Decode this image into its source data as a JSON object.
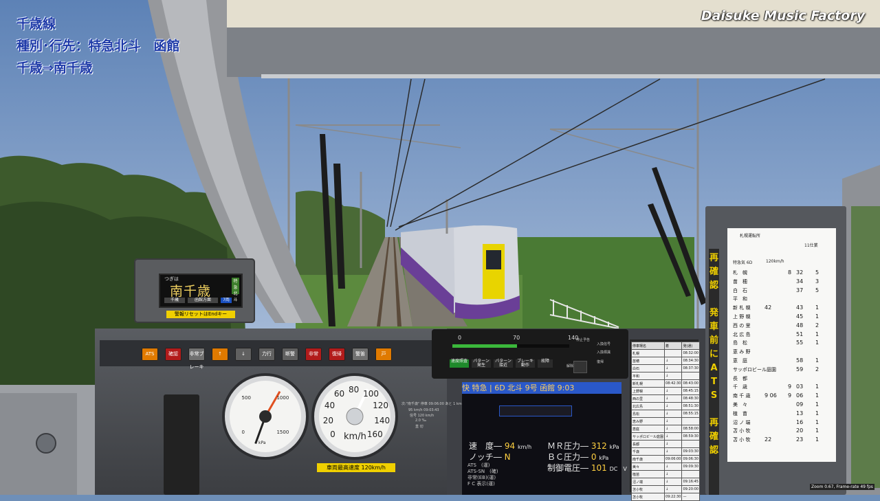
{
  "overlay": {
    "line_name": "千歳線",
    "service": "種別･行先：特急北斗　函館",
    "section": "千歳⇒南千歳",
    "watermark": "Daisuke Music Factory"
  },
  "destination_display": {
    "next_label": "つぎは",
    "station": "南千歳",
    "side_tag": "特急 北斗",
    "seg1": "千歳",
    "seg2": "函館方面",
    "car": "7両",
    "warning": "警報リセットはEndキー"
  },
  "buttons": [
    "ATS",
    "確認",
    "非常ブレーキ",
    "↑",
    "↓",
    "力行",
    "断警",
    "非常",
    "復帰",
    "警笛",
    "戸"
  ],
  "gauges": {
    "pressure_ticks": [
      "0",
      "500",
      "1000",
      "1500"
    ],
    "pressure_unit": "kPa",
    "speed_ticks": [
      "0",
      "20",
      "40",
      "60",
      "80",
      "100",
      "120",
      "140",
      "160"
    ],
    "speed_unit": "km/h",
    "speed_value_kmh": 95,
    "max_speed_label": "車両最高速度 120km/h"
  },
  "monitor": {
    "scale": [
      "0",
      "70",
      "140"
    ],
    "pattern_fill_fraction": 0.55,
    "labels": [
      "速度照査",
      "パターン発生",
      "パターン接近",
      "ブレーキ動作",
      "故障"
    ],
    "right_labels": [
      "停止予告",
      "入換信号",
      "入換標識",
      "解除",
      "復帰"
    ]
  },
  "next_info": {
    "line1": "次:\"南千歳\" 停車 09:06:00 あと 1 km",
    "line2": "95 km/h 09:03:43",
    "line3": "信号 120 km/h",
    "line4": "2.0 ‰",
    "line5": "直 切"
  },
  "info_panel": {
    "header": "快 特急 | 6D 北斗 9号 函館 9:03",
    "speed_label": "速　度",
    "speed_value": "94",
    "speed_unit": "km/h",
    "notch_label": "ノッチ",
    "notch_value": "N",
    "mr_label": "ＭＲ圧力",
    "mr_value": "312",
    "mr_unit": "kPa",
    "bc_label": "ＢＣ圧力",
    "bc_value": "0",
    "bc_unit": "kPa",
    "volt_label": "制御電圧",
    "volt_value": "101",
    "volt_unit": "DC　V",
    "small_rows": [
      "ATS　(運)",
      "ATS-SN　(確)",
      "非常(EB)(運)",
      "F C 表示(運)"
    ]
  },
  "station_table": {
    "headers": [
      "停車場名",
      "着",
      "発(通)"
    ],
    "rows": [
      [
        "札幌",
        "",
        "08:32:00"
      ],
      [
        "苗穂",
        "↓",
        "08:34:30"
      ],
      [
        "白石",
        "↓",
        "08:37:30"
      ],
      [
        "平和",
        "↓",
        ""
      ],
      [
        "新札幌",
        "08:42:30",
        "08:43:00"
      ],
      [
        "上野幌",
        "↓",
        "08:45:15"
      ],
      [
        "西の里",
        "↓",
        "08:48:30"
      ],
      [
        "北広島",
        "↓",
        "08:51:30"
      ],
      [
        "島松",
        "↓",
        "08:55:15"
      ],
      [
        "恵み野",
        "↓",
        ""
      ],
      [
        "恵庭",
        "↓",
        "08:58:00"
      ],
      [
        "サッポロビール庭園",
        "↓",
        "08:59:30"
      ],
      [
        "長都",
        "↓",
        ""
      ],
      [
        "千歳",
        "↓",
        "09:03:30"
      ],
      [
        "南千歳",
        "09:06:00",
        "09:06:30"
      ],
      [
        "美々",
        "↓",
        "09:09:30"
      ],
      [
        "植苗",
        "↓",
        ""
      ],
      [
        "沼ノ端",
        "↓",
        "09:16:45"
      ],
      [
        "苫小牧",
        "↓",
        "09:20:00"
      ],
      [
        "苫小牧",
        "09:22:30",
        "—"
      ]
    ]
  },
  "timetable": {
    "title": "札幌運転所",
    "sheet": "11仕業",
    "header_service": "特急気 6D",
    "header_speed": "120km/h",
    "rows": [
      [
        "札　幌",
        "",
        "8",
        "32",
        "5"
      ],
      [
        "苗　穂",
        "",
        "",
        "34",
        "3"
      ],
      [
        "白　石",
        "",
        "",
        "37",
        "5"
      ],
      [
        "平　和",
        "",
        "",
        "",
        ""
      ],
      [
        "新 札 幌",
        "42",
        "",
        "43",
        "1"
      ],
      [
        "上 野 幌",
        "",
        "",
        "45",
        "1"
      ],
      [
        "西 の 里",
        "",
        "",
        "48",
        "2"
      ],
      [
        "北 広 島",
        "",
        "",
        "51",
        "1"
      ],
      [
        "島　松",
        "",
        "",
        "55",
        "1"
      ],
      [
        "恵 み 野",
        "",
        "",
        "",
        ""
      ],
      [
        "恵　庭",
        "",
        "",
        "58",
        "1"
      ],
      [
        "サッポロビール庭園",
        "",
        "",
        "59",
        "2"
      ],
      [
        "長　都",
        "",
        "",
        "",
        ""
      ],
      [
        "千　歳",
        "",
        "9",
        "03",
        "1"
      ],
      [
        "南 千 歳",
        "9 06",
        "9",
        "06",
        "1"
      ],
      [
        "美　々",
        "",
        "",
        "09",
        "1"
      ],
      [
        "植　苗",
        "",
        "",
        "13",
        "1"
      ],
      [
        "沼 ノ 端",
        "",
        "",
        "16",
        "1"
      ],
      [
        "苫 小 牧",
        "",
        "",
        "20",
        "1"
      ],
      [
        "苫 小 牧",
        "22",
        "",
        "23",
        "1"
      ]
    ],
    "strip_text": "再確認　発車前にATS　再確認"
  },
  "status": {
    "zoom": "Zoom 0.67, Frame-rate 49 fps"
  },
  "colors": {
    "sky": "#6e8fb8",
    "console": "#4e5156",
    "accent_blue": "#2a58c9",
    "warning_yellow": "#f0d000"
  }
}
